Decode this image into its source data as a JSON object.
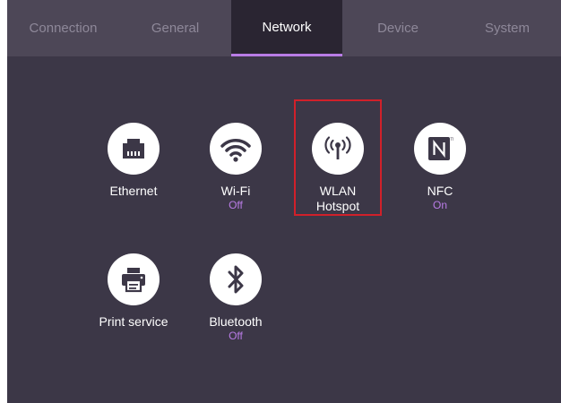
{
  "tabs": [
    {
      "label": "Connection",
      "active": false
    },
    {
      "label": "General",
      "active": false
    },
    {
      "label": "Network",
      "active": true
    },
    {
      "label": "Device",
      "active": false
    },
    {
      "label": "System",
      "active": false
    }
  ],
  "items": {
    "ethernet": {
      "label": "Ethernet",
      "icon": "ethernet-icon"
    },
    "wifi": {
      "label": "Wi-Fi",
      "status": "Off",
      "icon": "wifi-icon"
    },
    "hotspot": {
      "label_line1": "WLAN",
      "label_line2": "Hotspot",
      "icon": "hotspot-icon"
    },
    "nfc": {
      "label": "NFC",
      "status": "On",
      "icon": "nfc-icon"
    },
    "print": {
      "label": "Print service",
      "icon": "printer-icon"
    },
    "bluetooth": {
      "label": "Bluetooth",
      "status": "Off",
      "icon": "bluetooth-icon"
    }
  },
  "colors": {
    "background": "#3c3747",
    "tabbar": "#4d4757",
    "active_tab": "#2a2532",
    "accent": "#b97ce6",
    "highlight_border": "#d0202a"
  }
}
